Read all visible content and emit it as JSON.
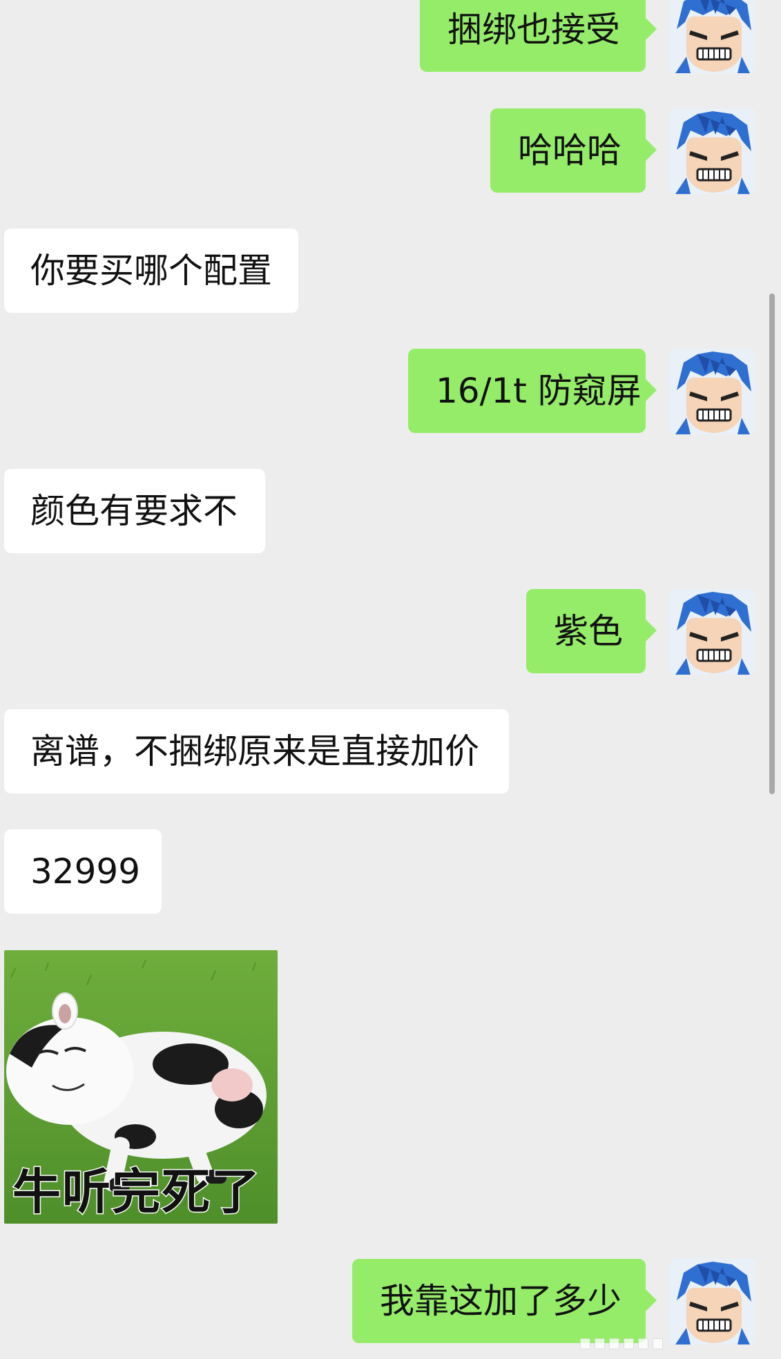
{
  "chat": {
    "messages": [
      {
        "side": "out",
        "text": "捆绑也接受"
      },
      {
        "side": "out",
        "text": "哈哈哈"
      },
      {
        "side": "in",
        "text": "你要买哪个配置"
      },
      {
        "side": "out",
        "text": "16/1t 防窥屏"
      },
      {
        "side": "in",
        "text": "颜色有要求不"
      },
      {
        "side": "out",
        "text": "紫色"
      },
      {
        "side": "in",
        "text": "离谱，不捆绑原来是直接加价"
      },
      {
        "side": "in",
        "text": "32999"
      },
      {
        "side": "in",
        "type": "sticker",
        "caption": "牛听完死了",
        "icon": "sleeping-cow-sticker"
      },
      {
        "side": "out",
        "text": "我靠这加了多少"
      }
    ]
  },
  "theme": {
    "background": "#ededed",
    "outgoing_bubble": "#95ec69",
    "incoming_bubble": "#ffffff",
    "text": "#111111"
  },
  "icons": {
    "avatar": "anime-character-avatar-icon"
  }
}
